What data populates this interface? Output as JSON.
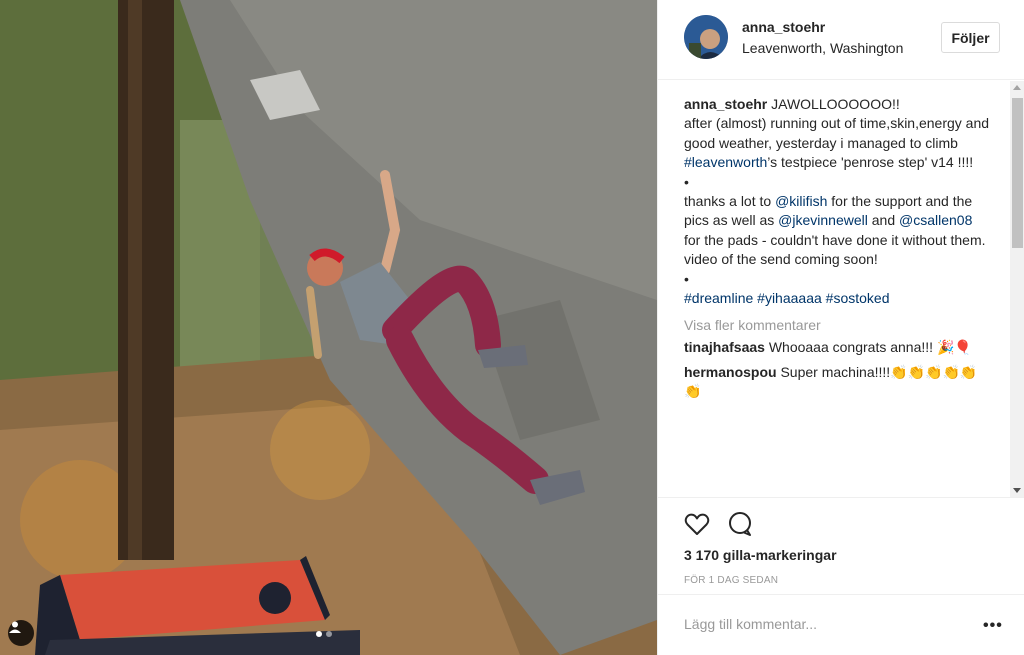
{
  "post": {
    "username": "anna_stoehr",
    "location": "Leavenworth, Washington",
    "follow_label": "Följer"
  },
  "caption": {
    "username": "anna_stoehr",
    "line1": " JAWOLLOOOOOO!!",
    "line2": "after (almost) running out of time,skin,energy and good weather, yesterday i managed to climb ",
    "tag_leavenworth": "#leavenworth",
    "line3": "’s testpiece 'penrose step' v14 !!!!",
    "bullet": "•",
    "thanks_a": "thanks a lot to ",
    "mention1": "@kilifish",
    "thanks_b": " for the support and the pics as well as ",
    "mention2": "@jkevinnewell",
    "thanks_c": " and ",
    "mention3": "@csallen08",
    "thanks_d": " for the pads - couldn't have done it without them. video of the send coming soon!",
    "bullet2": "•",
    "tag1": "#dreamline",
    "tag2": "#yihaaaaa",
    "tag3": "#sostoked"
  },
  "more_comments_label": "Visa fler kommentarer",
  "comments": [
    {
      "username": "tinajhafsaas",
      "text": "Whooaaa congrats anna!!! 🎉🎈"
    },
    {
      "username": "hermanospou",
      "text": "Super machina!!!!👏👏👏👏👏👏"
    }
  ],
  "likes_text": "3 170 gilla-markeringar",
  "time_text": "FÖR 1 DAG SEDAN",
  "add_comment_placeholder": "Lägg till kommentar...",
  "options_label": "•••"
}
